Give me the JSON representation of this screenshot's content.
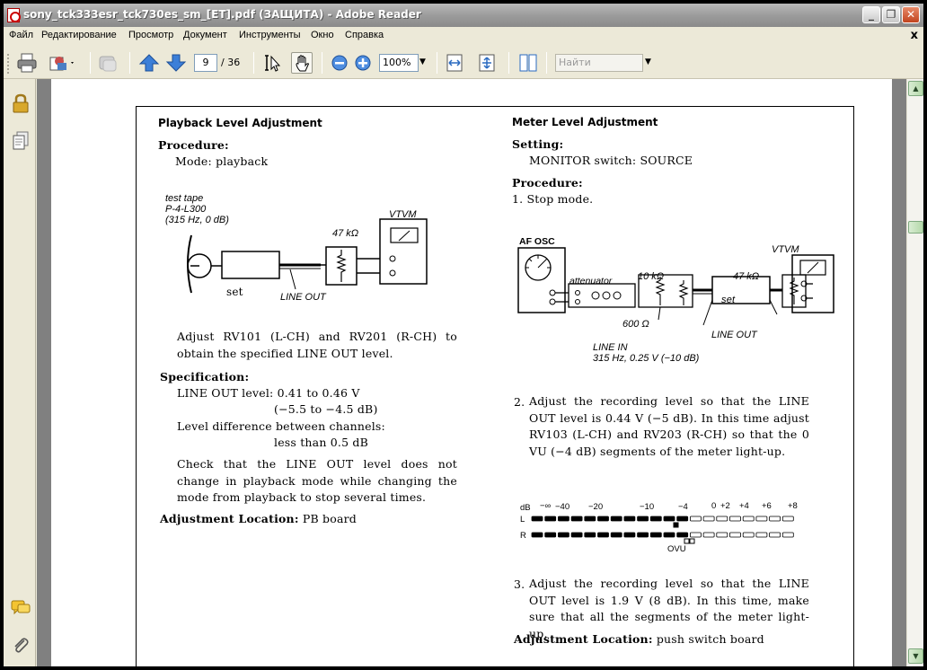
{
  "window": {
    "title": "sony_tck333esr_tck730es_sm_[ET].pdf (ЗАЩИТА) - Adobe Reader",
    "btn_minimize": "_",
    "btn_restore": "❐",
    "btn_close": "✕"
  },
  "menu": {
    "items": [
      "Файл",
      "Редактирование",
      "Просмотр",
      "Документ",
      "Инструменты",
      "Окно",
      "Справка"
    ],
    "close": "x"
  },
  "toolbar": {
    "page_current": "9",
    "page_total": "/ 36",
    "zoom": "100%",
    "search_placeholder": "Найти",
    "icons": [
      "print-icon",
      "email-icon",
      "collaborate-icon",
      "prev-page-icon",
      "next-page-icon",
      "select-tool-icon",
      "hand-tool-icon",
      "zoom-out-icon",
      "zoom-in-icon",
      "fit-width-icon",
      "fit-page-icon",
      "two-page-icon"
    ]
  },
  "left_panel": {
    "icons": [
      "lock-icon",
      "pages-icon",
      "comments-icon",
      "attachments-icon"
    ]
  },
  "document": {
    "left": {
      "heading": "Playback Level Adjustment",
      "procedure_label": "Procedure:",
      "mode": "Mode: playback",
      "diagram": {
        "tape_line1": "test tape",
        "tape_line2": "P-4-L300",
        "tape_line3": "(315 Hz, 0 dB)",
        "set": "set",
        "line_out": "LINE OUT",
        "resistor": "47 kΩ",
        "vtvm": "VTVM"
      },
      "adjust_text": "Adjust RV101 (L-CH) and RV201 (R-CH) to obtain the specified LINE OUT level.",
      "spec_label": "Specification:",
      "spec_line1": "LINE OUT level: 0.41 to 0.46 V",
      "spec_line2": "(−5.5 to −4.5 dB)",
      "spec_line3": "Level difference between channels:",
      "spec_line4": "less than 0.5 dB",
      "check_text": "Check that the LINE OUT level does not change in playback mode while changing the mode from playback to stop several times.",
      "location_label": "Adjustment Location:",
      "location_value": "PB board"
    },
    "right": {
      "heading": "Meter Level Adjustment",
      "setting_label": "Setting:",
      "setting_value": "MONITOR switch: SOURCE",
      "procedure_label": "Procedure:",
      "step1": "1. Stop mode.",
      "diagram": {
        "af_osc": "AF OSC",
        "attenuator": "attenuator",
        "r10k": "10 kΩ",
        "r600": "600 Ω",
        "set": "set",
        "r47k": "47 kΩ",
        "vtvm": "VTVM",
        "line_out": "LINE OUT",
        "line_in": "LINE IN",
        "line_in_spec": "315 Hz, 0.25 V (−10 dB)"
      },
      "step2_num": "2.",
      "step2": "Adjust the recording level so that the LINE OUT level is 0.44 V (−5 dB). In this time adjust RV103 (L-CH) and RV203 (R-CH) so that the 0 VU (−4 dB) segments of the meter light-up.",
      "meter": {
        "db_label": "dB",
        "scale": [
          "−∞",
          "−40",
          "−20",
          "−10",
          "−4",
          "0",
          "+2",
          "+4",
          "+6",
          "+8"
        ],
        "row_l": "L",
        "row_r": "R",
        "ovu": "OVU"
      },
      "step3_num": "3.",
      "step3": "Adjust the recording level so that the LINE OUT level is 1.9 V (8 dB). In this time, make sure that all the segments of the meter light-up.",
      "location_label": "Adjustment Location:",
      "location_value": "push switch board"
    }
  }
}
